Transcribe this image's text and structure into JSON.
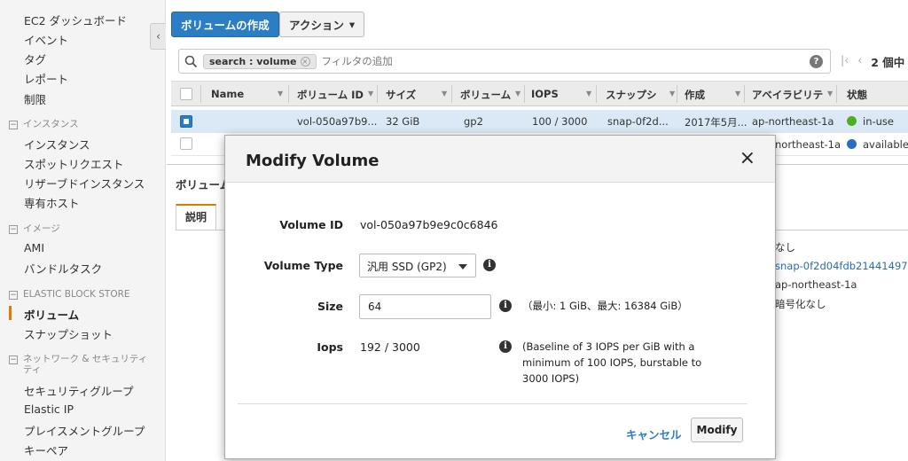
{
  "sidebar": {
    "items_top": [
      "EC2 ダッシュボード",
      "イベント",
      "タグ",
      "レポート",
      "制限"
    ],
    "sections": [
      {
        "header": "インスタンス",
        "items": [
          "インスタンス",
          "スポットリクエスト",
          "リザーブドインスタンス",
          "専有ホスト"
        ]
      },
      {
        "header": "イメージ",
        "items": [
          "AMI",
          "バンドルタスク"
        ]
      },
      {
        "header": "ELASTIC BLOCK STORE",
        "items": [
          "ボリューム",
          "スナップショット"
        ]
      },
      {
        "header": "ネットワーク & セキュリティ",
        "header2": "ティ",
        "items": [
          "セキュリティグループ",
          "Elastic IP",
          "プレイスメントグループ",
          "キーペア"
        ]
      }
    ],
    "collapse_icon": "‹"
  },
  "toolbar": {
    "create_label": "ボリュームの作成",
    "action_label": "アクション",
    "caret": "▾"
  },
  "search": {
    "token": "search : volume",
    "token_remove": "×",
    "placeholder": "フィルタの追加",
    "help": "?"
  },
  "pager": {
    "first": "|‹",
    "prev": "‹",
    "count": "2 個中"
  },
  "table": {
    "headers": [
      "Name",
      "ボリューム ID",
      "サイズ",
      "ボリューム",
      "IOPS",
      "スナップシ",
      "作成",
      "アベイラビリテ",
      "状態"
    ],
    "rows": [
      {
        "name": "",
        "volume_id": "vol-050a97b9...",
        "size": "32 GiB",
        "type": "gp2",
        "iops": "100 / 3000",
        "snapshot": "snap-0f2d...",
        "created": "2017年5月...",
        "az": "ap-northeast-1a",
        "state": "in-use",
        "state_color": "#4caf1f",
        "selected": true
      },
      {
        "az": "northeast-1a",
        "state": "available",
        "state_color": "#2b6cc4",
        "selected": false
      }
    ]
  },
  "details": {
    "title": "ボリューム",
    "tab_label": "説明",
    "values": [
      "なし",
      "snap-0f2d04fdb21441497",
      "ap-northeast-1a",
      "暗号化なし"
    ]
  },
  "modal": {
    "title": "Modify Volume",
    "close": "×",
    "volume_id_label": "Volume ID",
    "volume_id": "vol-050a97b9e9c0c6846",
    "volume_type_label": "Volume Type",
    "volume_type": "汎用 SSD (GP2)",
    "size_label": "Size",
    "size": "64",
    "size_hint": "（最小: 1 GiB、最大: 16384 GiB）",
    "iops_label": "Iops",
    "iops": "192 / 3000",
    "iops_hint_1": "(Baseline of 3 IOPS per GiB with a",
    "iops_hint_2": "minimum of 100 IOPS, burstable to",
    "iops_hint_3": "3000 IOPS)",
    "info": "i",
    "cancel_label": "キャンセル",
    "modify_label": "Modify"
  }
}
